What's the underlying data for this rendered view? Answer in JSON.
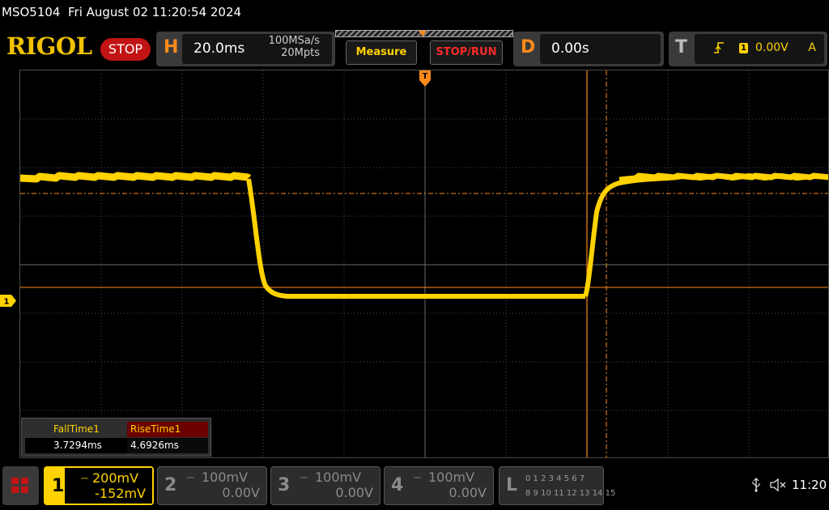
{
  "title_bar": {
    "model": "MSO5104",
    "datetime": "Fri August 02 11:20:54 2024"
  },
  "header": {
    "brand": "RIGOL",
    "run_state": "STOP",
    "horizontal": {
      "key": "H",
      "timebase": "20.0ms",
      "sample_rate": "100MSa/s",
      "memory_depth": "20Mpts"
    },
    "measure_button": "Measure",
    "stop_run_button": "STOP/RUN",
    "delay": {
      "key": "D",
      "value": "0.00s"
    },
    "trigger": {
      "key": "T",
      "edge_icon": "rising-edge-icon",
      "channel": "1",
      "level": "0.00V",
      "mode": "A"
    }
  },
  "colors": {
    "ch1": "#ffd200",
    "trigger": "#ff8a1a",
    "stop": "#c21414",
    "grid": "#4a4a4a"
  },
  "channel_marker": "1",
  "measurements": {
    "fall_time": {
      "name": "FallTime1",
      "value": "3.7294ms"
    },
    "rise_time": {
      "name": "RiseTime1",
      "value": "4.6926ms"
    }
  },
  "channels": [
    {
      "num": "1",
      "scale": "200mV",
      "offset": "-152mV",
      "active": true
    },
    {
      "num": "2",
      "scale": "100mV",
      "offset": "0.00V",
      "active": false
    },
    {
      "num": "3",
      "scale": "100mV",
      "offset": "0.00V",
      "active": false
    },
    {
      "num": "4",
      "scale": "100mV",
      "offset": "0.00V",
      "active": false
    }
  ],
  "logic_panel": {
    "key": "L",
    "row1": "0 1 2 3   4 5 6 7",
    "row2": "8  9 10 11  12 13 14 15"
  },
  "status": {
    "usb_icon": "usb-icon",
    "sound_icon": "speaker-muted-icon",
    "time": "11:20"
  }
}
